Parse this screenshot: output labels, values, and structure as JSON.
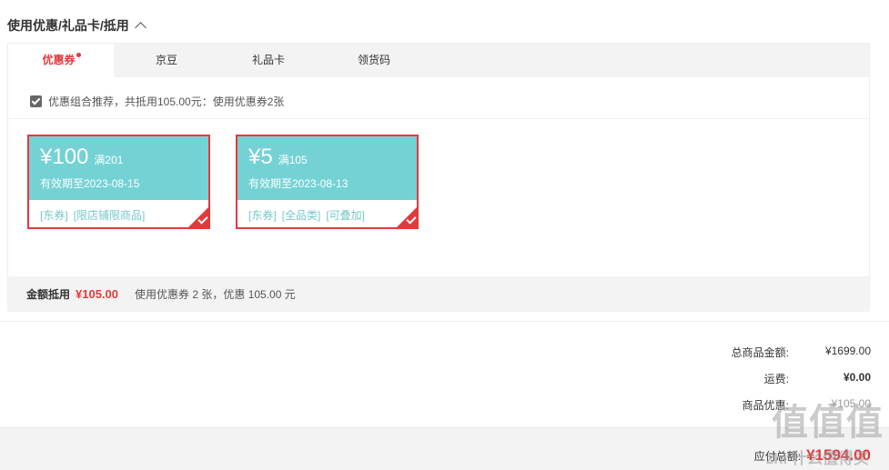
{
  "section": {
    "title": "使用优惠/礼品卡/抵用"
  },
  "tabs": [
    {
      "label": "优惠券",
      "active": true
    },
    {
      "label": "京豆"
    },
    {
      "label": "礼品卡"
    },
    {
      "label": "领货码"
    }
  ],
  "recommend": {
    "text": "优惠组合推荐，共抵用105.00元：使用优惠券2张"
  },
  "coupons": [
    {
      "amount": "¥100",
      "condition": "满201",
      "valid": "有效期至2023-08-15",
      "tags": [
        "[东券]",
        "[限店铺限商品]"
      ]
    },
    {
      "amount": "¥5",
      "condition": "满105",
      "valid": "有效期至2023-08-13",
      "tags": [
        "[东券]",
        "[全品类]",
        "[可叠加]"
      ]
    }
  ],
  "summary": {
    "label": "金额抵用",
    "amount": "¥105.00",
    "desc": "使用优惠券 2 张，优惠 105.00 元"
  },
  "totals": [
    {
      "label": "总商品金额:",
      "value": "¥1699.00"
    },
    {
      "label": "运费:",
      "value": "¥0.00"
    },
    {
      "label": "商品优惠:",
      "value": "-¥105.00"
    }
  ],
  "payable": {
    "label": "应付总额:",
    "value": "¥1594.00"
  },
  "watermark": {
    "logo": "值值值",
    "text": "zhi 什么值得买"
  },
  "colors": {
    "accent": "#e4393c",
    "coupon": "#74d2d5"
  }
}
